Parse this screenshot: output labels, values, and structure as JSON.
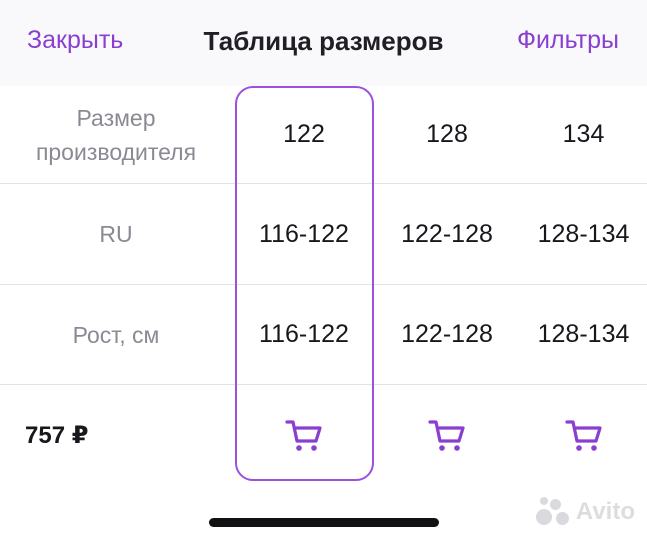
{
  "header": {
    "close_label": "Закрыть",
    "title": "Таблица размеров",
    "filters_label": "Фильтры"
  },
  "rows": [
    {
      "label": "Размер\nпроизводителя",
      "values": [
        "122",
        "128",
        "134"
      ]
    },
    {
      "label": "RU",
      "values": [
        "116-122",
        "122-128",
        "128-134"
      ]
    },
    {
      "label": "Рост, см",
      "values": [
        "116-122",
        "122-128",
        "128-134"
      ]
    }
  ],
  "footer": {
    "price": "757 ₽",
    "cart_icons": [
      "cart-icon",
      "cart-icon",
      "cart-icon"
    ]
  },
  "selected_column": 0,
  "watermark_text": "Avito",
  "colors": {
    "accent": "#8a3fd0",
    "highlight_border": "#9b50de",
    "label_gray": "#8a8a94",
    "text": "#17171c"
  }
}
